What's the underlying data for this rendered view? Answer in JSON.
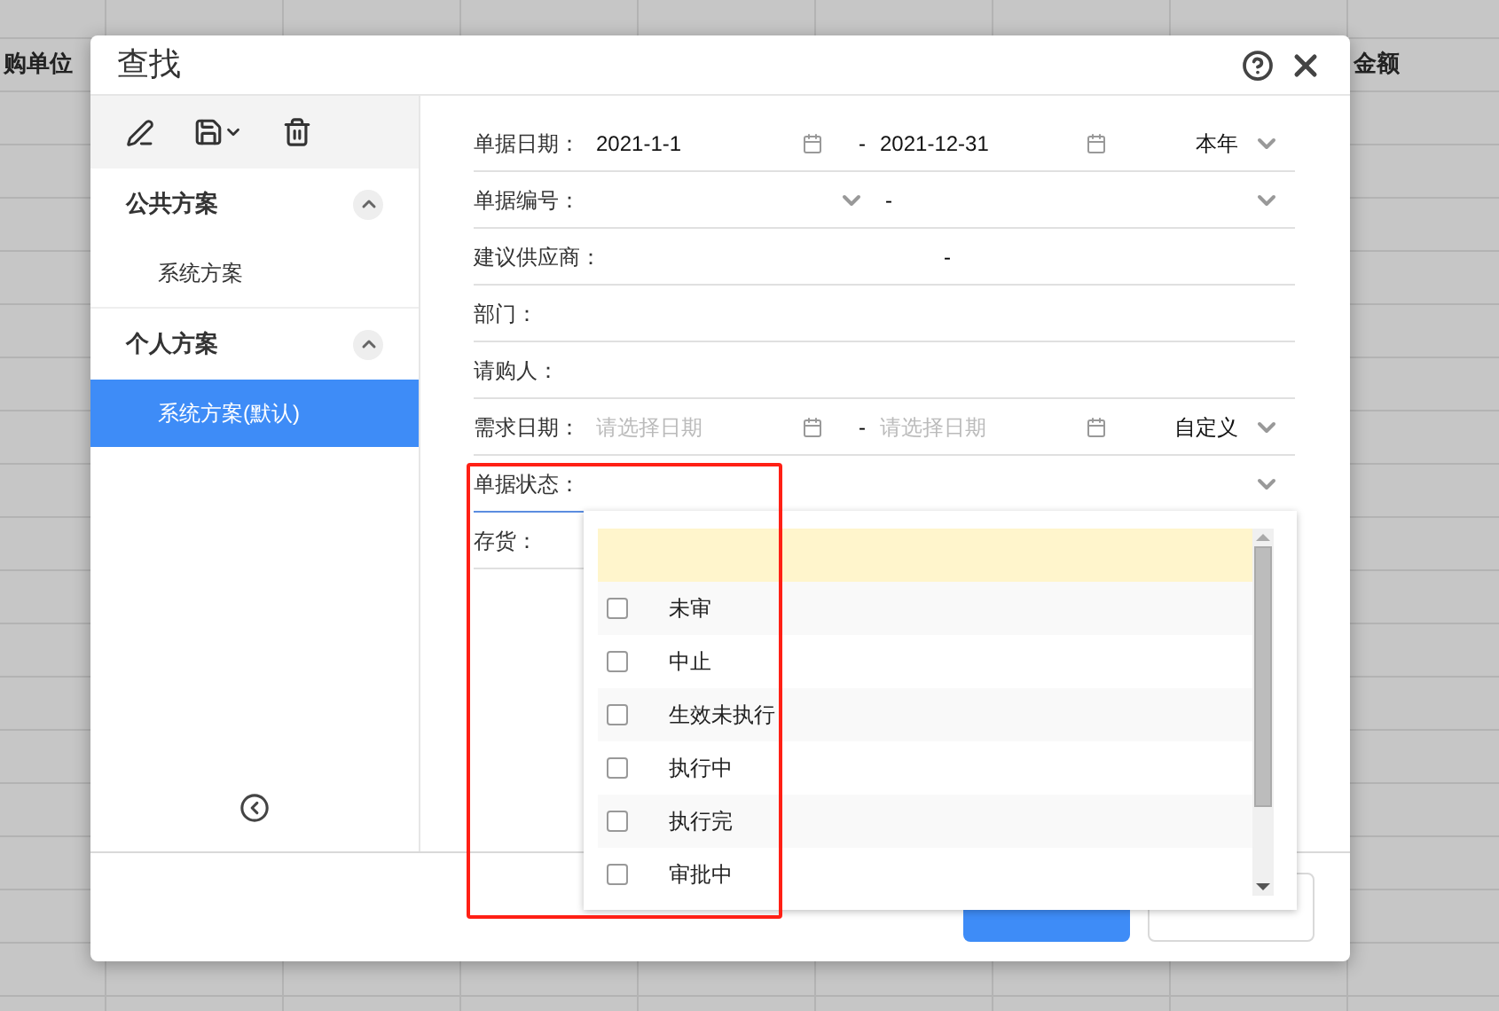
{
  "background_table": {
    "columns": [
      "购单位",
      "金额"
    ]
  },
  "dialog": {
    "title": "查找"
  },
  "sidebar": {
    "groups": [
      {
        "title": "公共方案",
        "expanded": true,
        "items": [
          {
            "label": "系统方案",
            "selected": false
          }
        ]
      },
      {
        "title": "个人方案",
        "expanded": true,
        "items": [
          {
            "label": "系统方案(默认)",
            "selected": true
          }
        ]
      }
    ]
  },
  "fields": [
    {
      "kind": "date_range",
      "label": "单据日期：",
      "from": "2021-1-1",
      "separator": "-",
      "to": "2021-12-31",
      "preset": "本年"
    },
    {
      "kind": "select_range",
      "label": "单据编号：",
      "separator": "-"
    },
    {
      "kind": "range",
      "label": "建议供应商：",
      "separator": "-"
    },
    {
      "kind": "text",
      "label": "部门："
    },
    {
      "kind": "text",
      "label": "请购人："
    },
    {
      "kind": "date_range",
      "label": "需求日期：",
      "from_placeholder": "请选择日期",
      "separator": "-",
      "to_placeholder": "请选择日期",
      "preset": "自定义"
    },
    {
      "kind": "select",
      "label": "单据状态：",
      "focused": true
    },
    {
      "kind": "text",
      "label": "存货："
    }
  ],
  "dropdown": {
    "options": [
      {
        "label": "未审",
        "checked": false
      },
      {
        "label": "中止",
        "checked": false
      },
      {
        "label": "生效未执行",
        "checked": false
      },
      {
        "label": "执行中",
        "checked": false
      },
      {
        "label": "执行完",
        "checked": false
      },
      {
        "label": "审批中",
        "checked": false
      }
    ]
  },
  "footer": {
    "buttons": [
      {
        "kind": "primary"
      },
      {
        "kind": "secondary"
      }
    ]
  }
}
